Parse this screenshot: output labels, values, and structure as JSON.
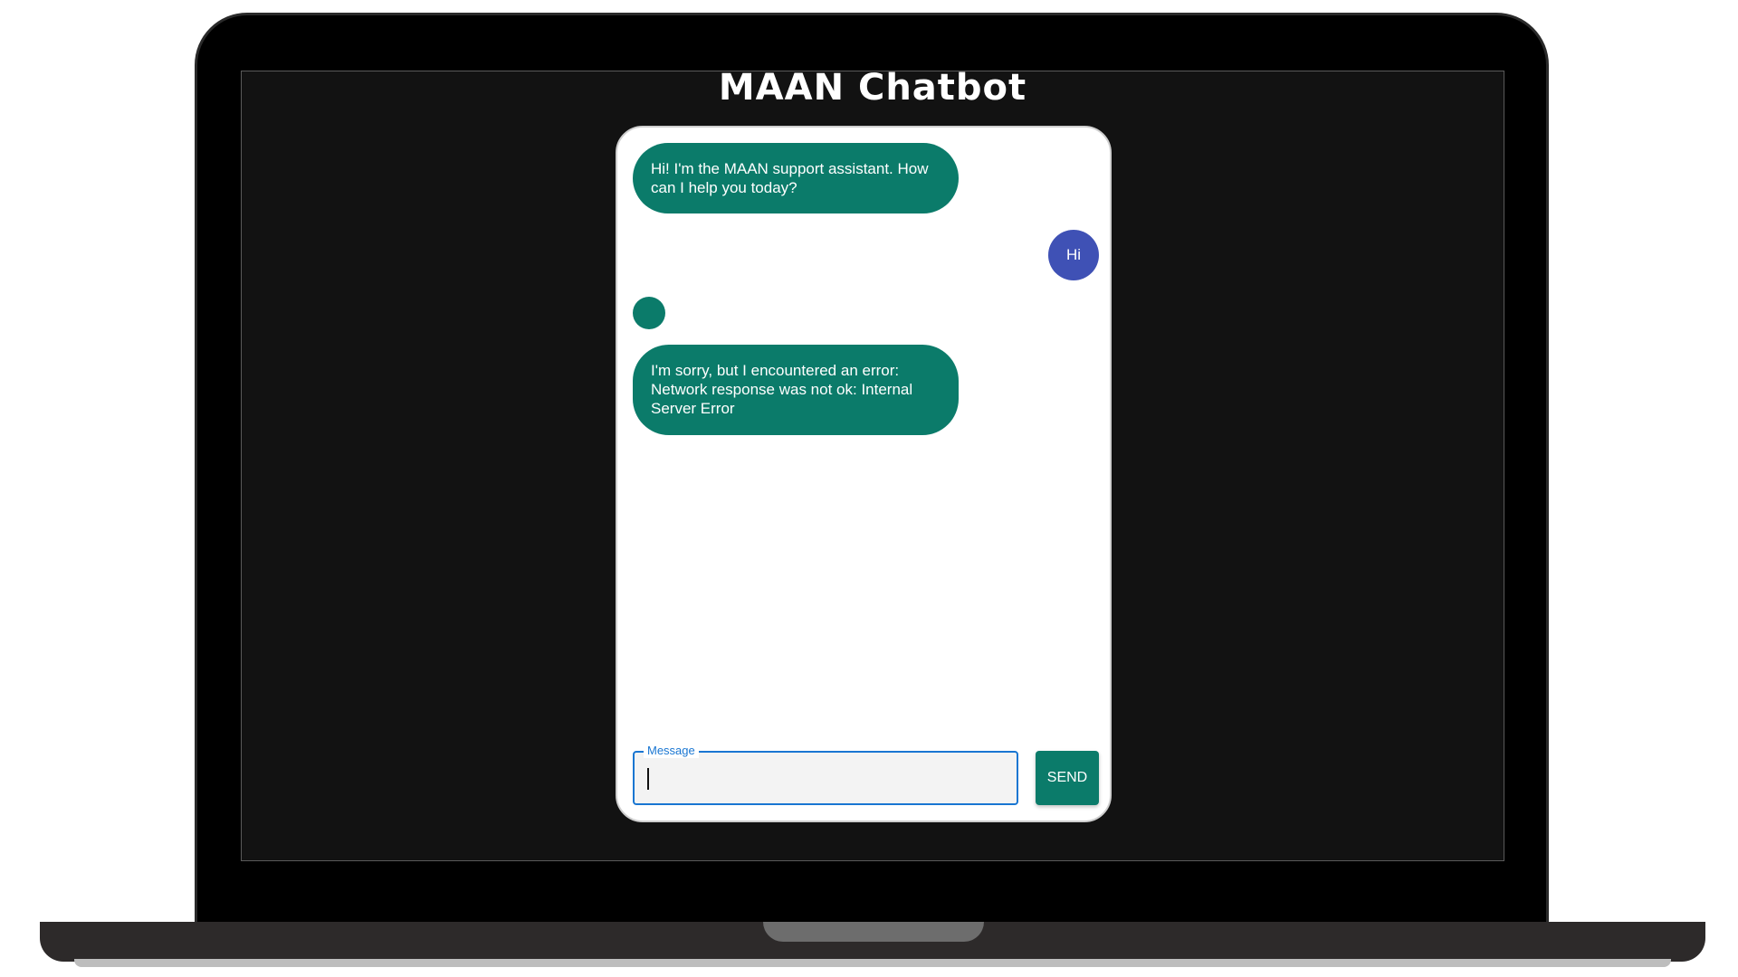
{
  "app": {
    "title": "MAAN Chatbot"
  },
  "chat": {
    "messages": [
      {
        "sender": "bot",
        "text": "Hi! I'm the MAAN support assistant. How can I help you today?"
      },
      {
        "sender": "user",
        "text": "Hi"
      },
      {
        "sender": "bot",
        "text": "I'm sorry, but I encountered an error: Network response was not ok: Internal Server Error"
      }
    ]
  },
  "input": {
    "label": "Message",
    "value": ""
  },
  "send_button": {
    "label": "SEND"
  },
  "colors": {
    "bot_bubble": "#0b7b6a",
    "user_bubble": "#3f51b5",
    "accent": "#1976d2",
    "screen_background": "#121212"
  }
}
